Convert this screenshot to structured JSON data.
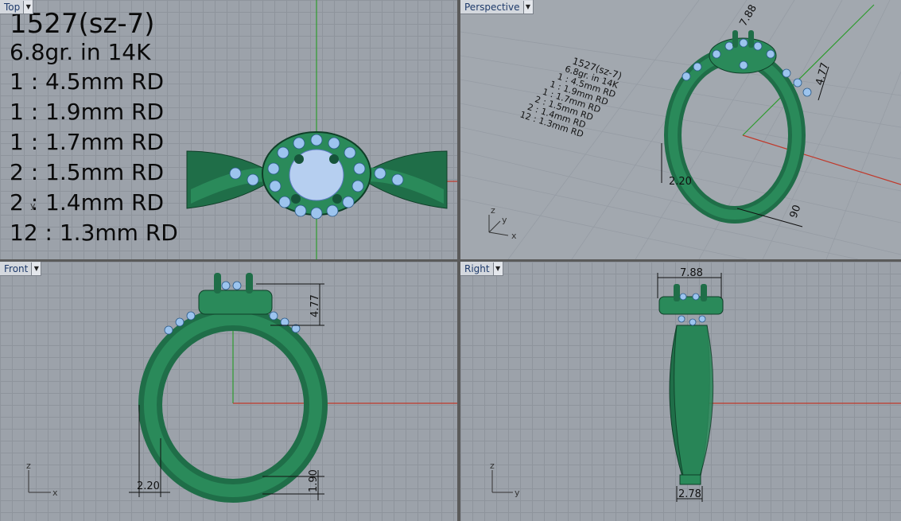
{
  "viewports": {
    "top": {
      "label": "Top"
    },
    "perspective": {
      "label": "Perspective"
    },
    "front": {
      "label": "Front"
    },
    "right": {
      "label": "Right"
    }
  },
  "notes": {
    "title": "1527(sz-7)",
    "weight": "6.8gr.  in 14K",
    "stones": [
      "1 : 4.5mm RD",
      "1 : 1.9mm RD",
      "1 : 1.7mm RD",
      "2 : 1.5mm RD",
      "2 : 1.4mm RD",
      "12 : 1.3mm RD"
    ]
  },
  "dimensions": {
    "head_height": "4.77",
    "head_width": "7.88",
    "band_thickness": "2.20",
    "band_bottom_height": "1.90",
    "band_bottom_width": "2.78",
    "persp_small": "90"
  },
  "axes": {
    "x": "x",
    "y": "y",
    "z": "z"
  },
  "colors": {
    "ring": "#2a8a5a",
    "ring_dark": "#16543a",
    "stones": "#9cc4ee",
    "axis_x": "#c0392b",
    "axis_y": "#2e9b2e",
    "viewport_bg": "#9ca2aa",
    "grid": "#8e949c"
  }
}
